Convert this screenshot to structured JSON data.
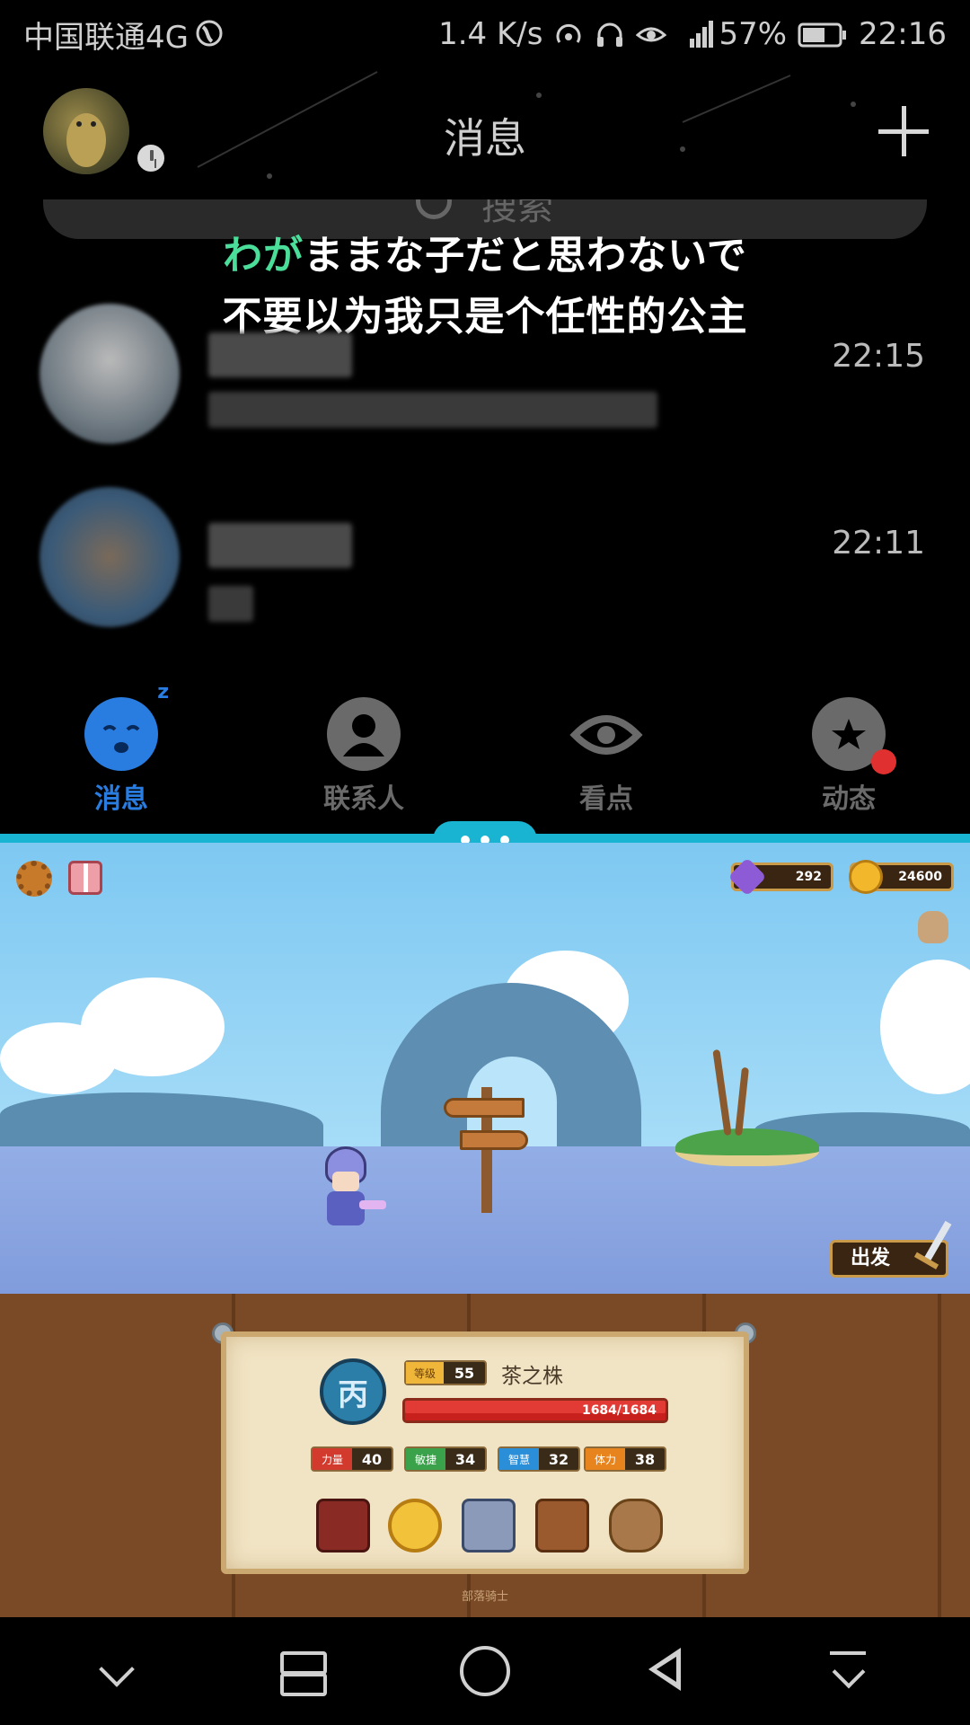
{
  "status_bar": {
    "carrier": "中国联通4G",
    "speed": "1.4 K/s",
    "battery": "57%",
    "time": "22:16"
  },
  "qq": {
    "title": "消息",
    "search_placeholder": "搜索",
    "lyric_line1_accent": "わが",
    "lyric_line1_rest": "ままな子だと思わないで",
    "lyric_line2": "不要以为我只是个任性的公主",
    "chats": [
      {
        "time": "22:15"
      },
      {
        "time": "22:11"
      }
    ],
    "tabs": [
      {
        "label": "消息",
        "icon": "sleeping-face-icon",
        "active": true
      },
      {
        "label": "联系人",
        "icon": "person-icon",
        "active": false
      },
      {
        "label": "看点",
        "icon": "eye-icon",
        "active": false
      },
      {
        "label": "动态",
        "icon": "planet-star-icon",
        "active": false
      }
    ],
    "tab_active_color": "#2a7de0"
  },
  "game": {
    "gems": "292",
    "coins": "24600",
    "go_button": "出发",
    "rank_badge": "丙",
    "level_tag": "等级",
    "level": "55",
    "hero_name": "茶之株",
    "hp": "1684/1684",
    "hp_fraction": 1.0,
    "stats": [
      {
        "label": "力量",
        "value": "40",
        "color": "#d23a2e"
      },
      {
        "label": "敏捷",
        "value": "34",
        "color": "#3aa24a"
      },
      {
        "label": "智慧",
        "value": "32",
        "color": "#2a8ed8"
      },
      {
        "label": "体力",
        "value": "38",
        "color": "#e8841e"
      }
    ],
    "items": [
      "book-icon",
      "gold-coin-icon",
      "card-deck-icon",
      "chest-potion-icon",
      "gem-bag-icon"
    ],
    "footer": "部落骑士"
  },
  "nav": [
    "chevron-down-icon",
    "recent-apps-icon",
    "home-icon",
    "back-icon",
    "hide-nav-icon"
  ]
}
